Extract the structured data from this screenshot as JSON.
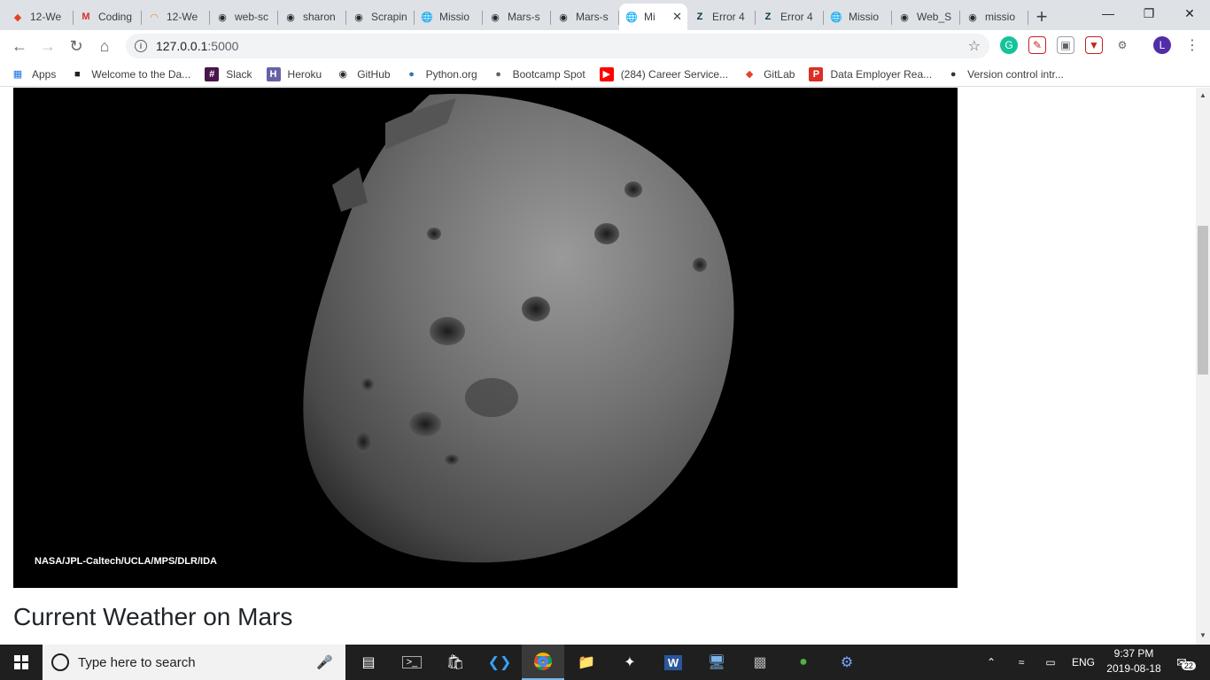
{
  "tabs": [
    {
      "label": "12-We",
      "icon": "gitlab-icon",
      "color": "#e24329"
    },
    {
      "label": "Coding",
      "icon": "gmail-icon",
      "color": "#d93025"
    },
    {
      "label": "12-We",
      "icon": "loading-icon",
      "color": "#f08a24"
    },
    {
      "label": "web-sc",
      "icon": "github-icon",
      "color": "#24292e"
    },
    {
      "label": "sharon",
      "icon": "github-icon",
      "color": "#24292e"
    },
    {
      "label": "Scrapin",
      "icon": "github-icon",
      "color": "#24292e"
    },
    {
      "label": "Missio",
      "icon": "globe-icon",
      "color": "#5f6368"
    },
    {
      "label": "Mars-s",
      "icon": "github-icon",
      "color": "#24292e"
    },
    {
      "label": "Mars-s",
      "icon": "github-icon",
      "color": "#24292e"
    },
    {
      "label": "Mi",
      "icon": "globe-icon",
      "color": "#5f6368",
      "active": true
    },
    {
      "label": "Error 4",
      "icon": "zendesk-icon",
      "color": "#03363d"
    },
    {
      "label": "Error 4",
      "icon": "zendesk-icon",
      "color": "#03363d"
    },
    {
      "label": "Missio",
      "icon": "globe-icon",
      "color": "#5f6368"
    },
    {
      "label": "Web_S",
      "icon": "github-icon",
      "color": "#24292e"
    },
    {
      "label": "missio",
      "icon": "github-icon",
      "color": "#24292e"
    }
  ],
  "address": {
    "host": "127.0.0.1",
    "port": ":5000"
  },
  "profile_initial": "L",
  "bookmarks": [
    {
      "label": "Apps",
      "icon": "apps-grid-icon"
    },
    {
      "label": "Welcome to the Da...",
      "icon": "book-icon"
    },
    {
      "label": "Slack",
      "icon": "slack-icon"
    },
    {
      "label": "Heroku",
      "icon": "heroku-icon"
    },
    {
      "label": "GitHub",
      "icon": "github-icon"
    },
    {
      "label": "Python.org",
      "icon": "python-icon"
    },
    {
      "label": "Bootcamp Spot",
      "icon": "globe-icon"
    },
    {
      "label": "(284) Career Service...",
      "icon": "youtube-icon"
    },
    {
      "label": "GitLab",
      "icon": "gitlab-icon"
    },
    {
      "label": "Data Employer Rea...",
      "icon": "pdf-icon"
    },
    {
      "label": "Version control intr...",
      "icon": "atlassian-icon"
    }
  ],
  "page": {
    "image_credit": "NASA/JPL-Caltech/UCLA/MPS/DLR/IDA",
    "section_heading": "Current Weather on Mars"
  },
  "taskbar": {
    "search_placeholder": "Type here to search",
    "language": "ENG",
    "time": "9:37 PM",
    "date": "2019-08-18",
    "notification_count": "22"
  }
}
